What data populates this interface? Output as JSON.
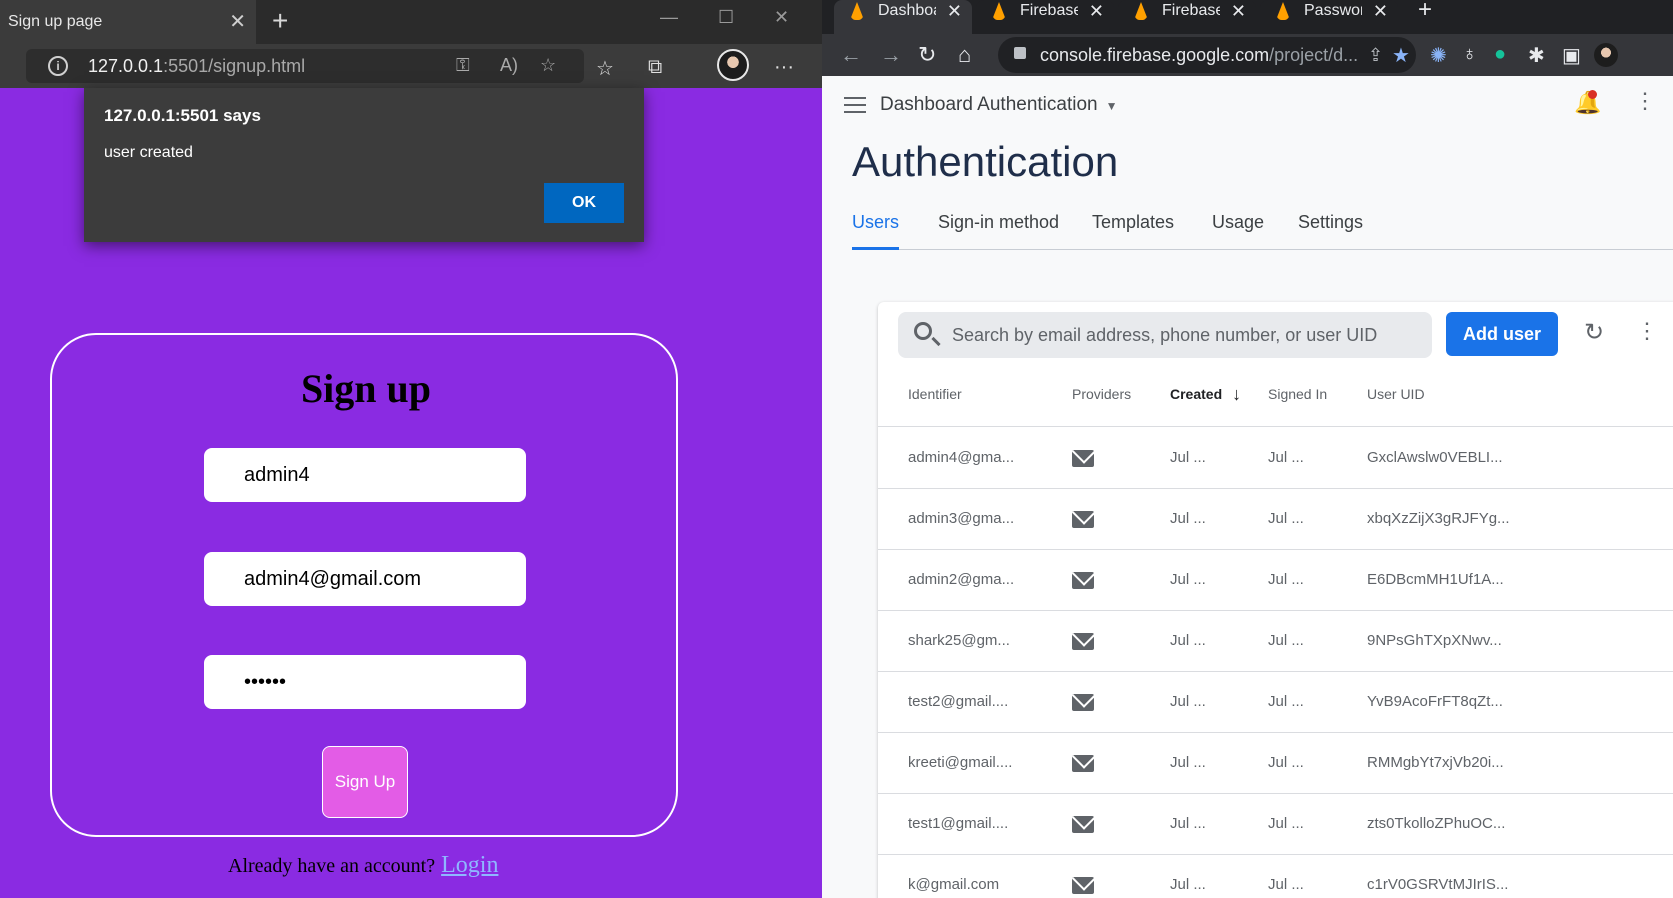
{
  "left_window": {
    "tab_title": "Sign up page",
    "tab_close": "✕",
    "new_tab": "+",
    "window_controls": [
      "—",
      "☐",
      "✕"
    ],
    "address": {
      "host": "127.0.0.1",
      "port_path": ":5501/signup.html"
    },
    "toolbar_icons": [
      "key-icon",
      "read-aloud-icon",
      "add-favorite-icon",
      "favorites-icon",
      "collections-icon",
      "profile-avatar",
      "more-icon"
    ],
    "dialog": {
      "title": "127.0.0.1:5501 says",
      "message": "user created",
      "ok_label": "OK"
    },
    "form": {
      "heading": "Sign up",
      "username_value": "admin4",
      "email_value": "admin4@gmail.com",
      "password_value": "••••••",
      "submit_label": "Sign Up",
      "already_text": "Already have an account?",
      "login_link": "Login"
    },
    "colors": {
      "page_bg": "#8a2be2",
      "button_bg": "#e35ce6",
      "ok_button": "#0067c0"
    }
  },
  "right_window": {
    "tabs": [
      {
        "label": "Dashboard",
        "active": true
      },
      {
        "label": "Firebase",
        "active": false
      },
      {
        "label": "Firebase",
        "active": false
      },
      {
        "label": "Password",
        "active": false
      }
    ],
    "url": {
      "host": "console.firebase.google.com",
      "path": "/project/d..."
    },
    "project_name": "Dashboard Authentication",
    "page_title": "Authentication",
    "nav_tabs": [
      "Users",
      "Sign-in method",
      "Templates",
      "Usage",
      "Settings"
    ],
    "search_placeholder": "Search by email address, phone number, or user UID",
    "add_user_label": "Add user",
    "columns": {
      "identifier": "Identifier",
      "providers": "Providers",
      "created": "Created",
      "signed_in": "Signed In",
      "uid": "User UID"
    },
    "users": [
      {
        "identifier": "admin4@gma...",
        "created": "Jul ...",
        "signed_in": "Jul ...",
        "uid": "GxclAwslw0VEBLI..."
      },
      {
        "identifier": "admin3@gma...",
        "created": "Jul ...",
        "signed_in": "Jul ...",
        "uid": "xbqXzZijX3gRJFYg..."
      },
      {
        "identifier": "admin2@gma...",
        "created": "Jul ...",
        "signed_in": "Jul ...",
        "uid": "E6DBcmMH1Uf1A..."
      },
      {
        "identifier": "shark25@gm...",
        "created": "Jul ...",
        "signed_in": "Jul ...",
        "uid": "9NPsGhTXpXNwv..."
      },
      {
        "identifier": "test2@gmail....",
        "created": "Jul ...",
        "signed_in": "Jul ...",
        "uid": "YvB9AcoFrFT8qZt..."
      },
      {
        "identifier": "kreeti@gmail....",
        "created": "Jul ...",
        "signed_in": "Jul ...",
        "uid": "RMMgbYt7xjVb20i..."
      },
      {
        "identifier": "test1@gmail....",
        "created": "Jul ...",
        "signed_in": "Jul ...",
        "uid": "zts0TkolloZPhuOC..."
      },
      {
        "identifier": "k@gmail.com",
        "created": "Jul ...",
        "signed_in": "Jul ...",
        "uid": "c1rV0GSRVtMJIrIS..."
      }
    ],
    "colors": {
      "accent": "#1a73e8",
      "title": "#1f2e4a"
    }
  }
}
